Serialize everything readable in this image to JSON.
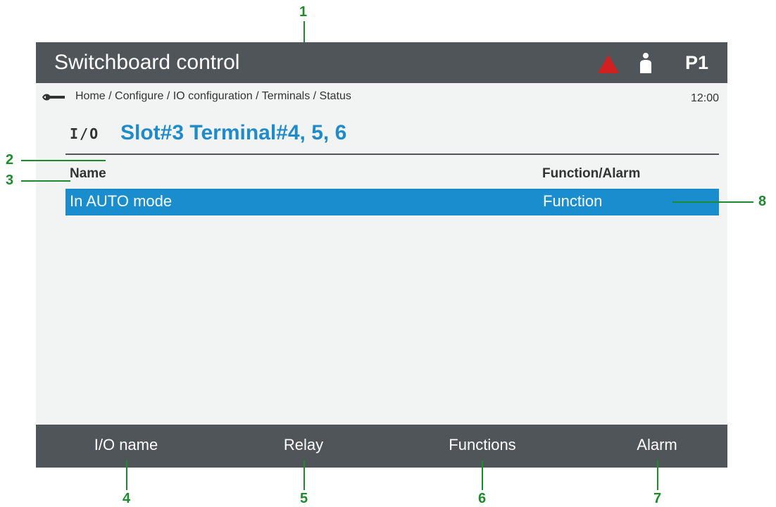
{
  "header": {
    "title": "Switchboard control",
    "alarm_icon": "alarm-triangle-icon",
    "user_icon": "user-icon",
    "page_id": "P1"
  },
  "breadcrumb": {
    "icon": "wrench-icon",
    "path": "Home / Configure / IO configuration / Terminals / Status",
    "time": "12:00"
  },
  "page": {
    "io_icon_text": "I/O",
    "title": "Slot#3 Terminal#4, 5, 6"
  },
  "table": {
    "columns": [
      "Name",
      "Function/Alarm"
    ],
    "rows": [
      {
        "name": "In AUTO mode",
        "function_alarm": "Function",
        "selected": true
      }
    ]
  },
  "softkeys": [
    "I/O name",
    "Relay",
    "Functions",
    "Alarm"
  ],
  "callouts": [
    "1",
    "2",
    "3",
    "4",
    "5",
    "6",
    "7",
    "8"
  ],
  "colors": {
    "header_bg": "#50555a",
    "accent_blue": "#1f8bcb",
    "selected_row": "#1a8dcf",
    "alarm_red": "#d22020",
    "callout_green": "#1d8a2e"
  }
}
